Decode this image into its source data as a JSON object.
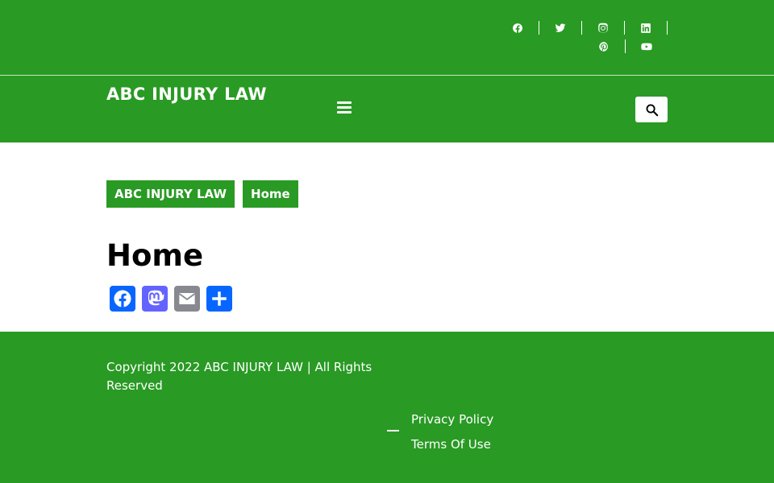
{
  "header": {
    "social_icons": [
      "facebook-icon",
      "twitter-icon",
      "instagram-icon",
      "linkedin-icon",
      "pinterest-icon",
      "youtube-icon"
    ],
    "brand": "ABC INJURY LAW",
    "menu_icon": "hamburger-icon",
    "search_icon": "search-icon"
  },
  "breadcrumb": {
    "items": [
      "ABC INJURY LAW",
      "Home"
    ]
  },
  "main": {
    "title": "Home",
    "share_icons": [
      "facebook-share-icon",
      "mastodon-share-icon",
      "email-share-icon",
      "share-icon"
    ]
  },
  "footer": {
    "copyright": "Copyright 2022 ABC INJURY LAW | All Rights Reserved",
    "links": [
      "Privacy Policy",
      "Terms Of Use"
    ]
  },
  "colors": {
    "brand_green": "#299a24",
    "facebook_blue": "#0866ff",
    "mastodon_purple": "#6364ff",
    "email_gray": "#888990",
    "share_blue": "#0666ff"
  }
}
